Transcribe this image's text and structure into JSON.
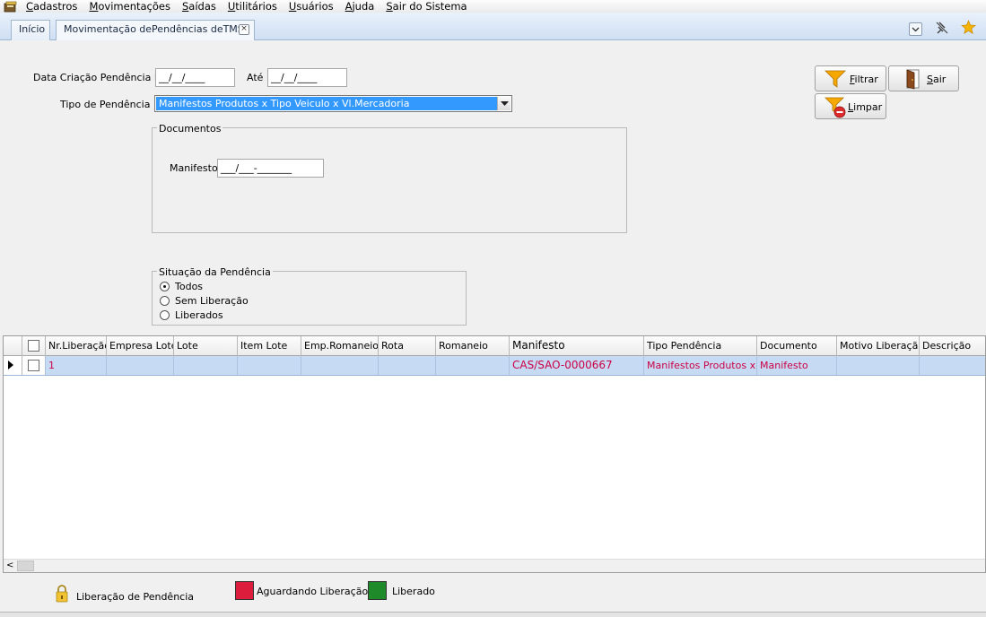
{
  "menu": {
    "items": [
      "Cadastros",
      "Movimentações",
      "Saídas",
      "Utilitários",
      "Usuários",
      "Ajuda",
      "Sair do Sistema"
    ]
  },
  "tabs": [
    {
      "label": "Início"
    },
    {
      "label": "Movimentação dePendências deTMS"
    }
  ],
  "filters": {
    "data_criacao_label": "Data Criação Pendência De",
    "data_de_value": "__/__/____",
    "ate_label": "Até",
    "data_ate_value": "__/__/____",
    "tipo_label": "Tipo de Pendência",
    "tipo_value": "Manifestos Produtos x Tipo Veiculo x Vl.Mercadoria"
  },
  "documentos": {
    "title": "Documentos",
    "manifesto_label": "Manifesto",
    "manifesto_value": "___/___-_______"
  },
  "situacao": {
    "title": "Situação da Pendência",
    "options": [
      "Todos",
      "Sem Liberação",
      "Liberados"
    ],
    "selected": "Todos"
  },
  "buttons": {
    "filtrar": "Filtrar",
    "sair": "Sair",
    "limpar": "Limpar"
  },
  "grid": {
    "columns": [
      "Nr.Liberação",
      "Empresa Lote",
      "Lote",
      "Item Lote",
      "Emp.Romaneio",
      "Rota",
      "Romaneio",
      "Manifesto",
      "Tipo Pendência",
      "Documento",
      "Motivo Liberação",
      "Descrição"
    ],
    "rows": [
      {
        "nr_liberacao": "1",
        "empresa_lote": "",
        "lote": "",
        "item_lote": "",
        "emp_romaneio": "",
        "rota": "",
        "romaneio": "",
        "manifesto": "CAS/SAO-0000667",
        "tipo_pendencia": "Manifestos Produtos x",
        "documento": "Manifesto",
        "motivo_liberacao": "",
        "descricao": ""
      }
    ],
    "scroll_left_glyph": "<"
  },
  "footer": {
    "liberacao_label": "Liberação de Pendência",
    "legend_aguardando": "Aguardando Liberação",
    "legend_liberado": "Liberado"
  },
  "colors": {
    "aguardando": "#dc1e3c",
    "liberado": "#1f8a2a",
    "row_text": "#cc0044",
    "selected_row": "#c7daf3"
  }
}
